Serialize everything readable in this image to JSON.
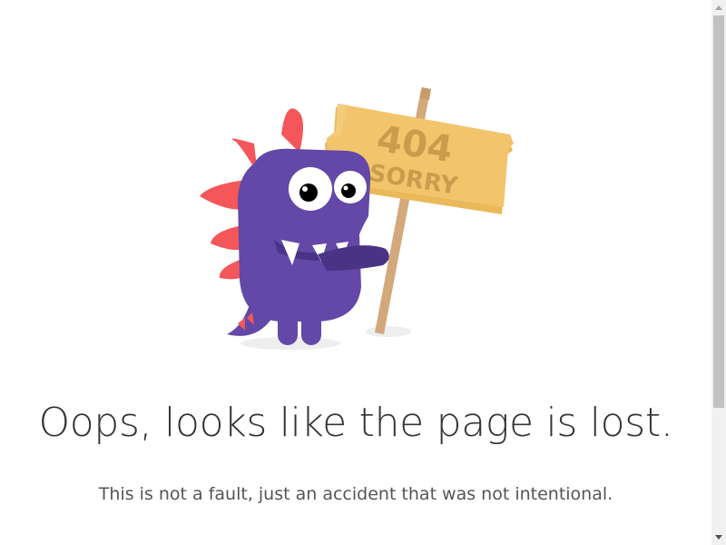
{
  "error": {
    "sign_code": "404",
    "sign_word": "SORRY",
    "headline": "Oops, looks like the page is lost.",
    "message": "This is not a fault, just an accident that was not intentional."
  },
  "illustration": {
    "subject": "purple monster holding a wooden sign",
    "colors": {
      "monster_body": "#6348a8",
      "monster_spikes": "#f4575a",
      "sign_board": "#f2c46c",
      "sign_text": "#c99d4c",
      "sign_post": "#d3a87a",
      "shadow": "#eeeeee"
    }
  }
}
